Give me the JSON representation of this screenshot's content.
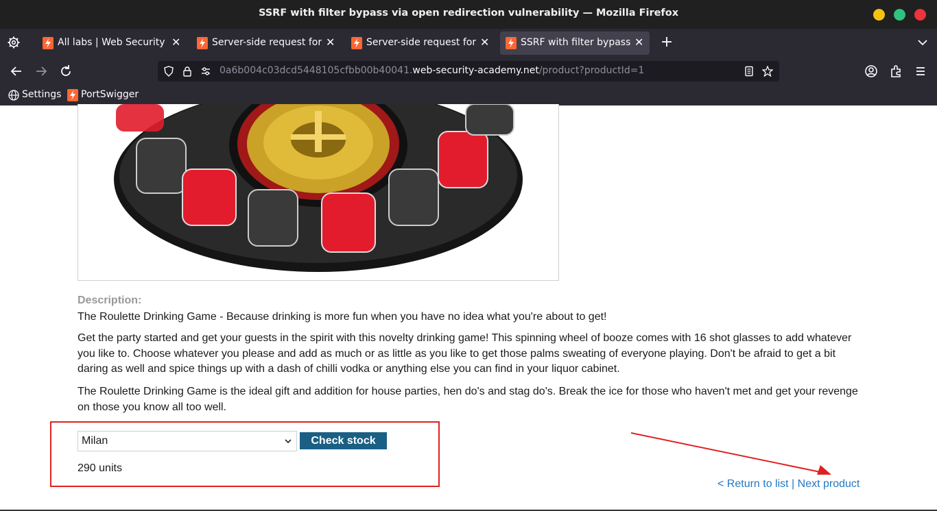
{
  "window": {
    "title": "SSRF with filter bypass via open redirection vulnerability — Mozilla Firefox"
  },
  "tabs": [
    {
      "label": "All labs | Web Security Academy",
      "active": false
    },
    {
      "label": "Server-side request forgery",
      "active": false
    },
    {
      "label": "Server-side request forgery",
      "active": false
    },
    {
      "label": "SSRF with filter bypass via open redirection vulnerability",
      "active": true
    }
  ],
  "navbar": {
    "url_prefix": "0a6b004c03dcd5448105cfbb00b40041.",
    "url_host": "web-security-academy.net",
    "url_path": "/product?productId=1"
  },
  "bookmarks": [
    {
      "label": "Settings",
      "icon": "globe-icon"
    },
    {
      "label": "PortSwigger",
      "icon": "portswigger-icon"
    }
  ],
  "product": {
    "image_alt": "The Roulette Drinking Game",
    "description_label": "Description:",
    "paragraphs": [
      "The Roulette Drinking Game - Because drinking is more fun when you have no idea what you're about to get!",
      "Get the party started and get your guests in the spirit with this novelty drinking game! This spinning wheel of booze comes with 16 shot glasses to add whatever you like to. Choose whatever you please and add as much or as little as you like to get those palms sweating of everyone playing. Don't be afraid to get a bit daring as well and spice things up with a dash of chilli vodka or anything else you can find in your liquor cabinet.",
      "The Roulette Drinking Game is the ideal gift and addition for house parties, hen do's and stag do's. Break the ice for those who haven't met and get your revenge on those you know all too well."
    ]
  },
  "stock": {
    "selected_store": "Milan",
    "check_button": "Check stock",
    "result": "290 units"
  },
  "links": {
    "return": "< Return to list",
    "separator": " | ",
    "next": "Next product"
  },
  "colors": {
    "annotation_red": "#e02020",
    "button_blue": "#1a5f84",
    "link_blue": "#2477c2",
    "portswigger_orange": "#ff6633"
  }
}
